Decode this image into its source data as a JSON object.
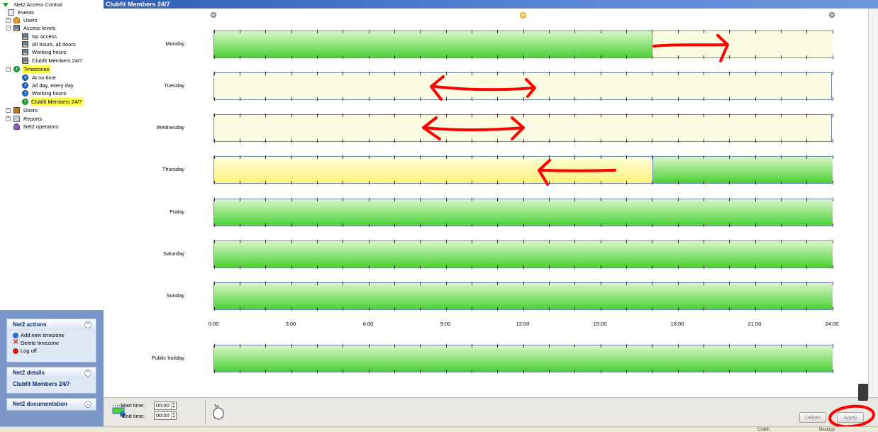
{
  "window": {
    "title": "Clubfit Members 24/7"
  },
  "tree": {
    "root": "Net2 Access Control",
    "events": "Events",
    "users": "Users",
    "access_levels": "Access levels",
    "access_level_items": [
      "No access",
      "All hours, all doors",
      "Working hours",
      "Clubfit Members 24/7"
    ],
    "timezones": "Timezones",
    "timezone_items": [
      "At no time",
      "All day, every day",
      "Working hours",
      "Clubfit Members 24/7"
    ],
    "doors": "Doors",
    "reports": "Reports",
    "operators": "Net2 operators"
  },
  "panels": {
    "actions": {
      "title": "Net2 actions",
      "items": [
        "Add new timezone",
        "Delete timezone",
        "Log off"
      ]
    },
    "details": {
      "title": "Net2 details",
      "value": "Clubfit Members 24/7"
    },
    "documentation": {
      "title": "Net2 documentation"
    }
  },
  "schedule": {
    "days": [
      {
        "label": "Monday",
        "on_from": 0,
        "on_to": 17
      },
      {
        "label": "Tuesday",
        "on_from": 0,
        "on_to": 0
      },
      {
        "label": "Wednesday",
        "on_from": 0,
        "on_to": 0
      },
      {
        "label": "Thursday",
        "on_from": 17,
        "on_to": 24
      },
      {
        "label": "Friday",
        "on_from": 0,
        "on_to": 24
      },
      {
        "label": "Saturday",
        "on_from": 0,
        "on_to": 24
      },
      {
        "label": "Sunday",
        "on_from": 0,
        "on_to": 24
      }
    ],
    "public_holiday": {
      "label": "Public holiday",
      "on_from": 0,
      "on_to": 24
    },
    "hour_labels": [
      "0:00",
      "3:00",
      "6:00",
      "9:00",
      "12:00",
      "15:00",
      "18:00",
      "21:00",
      "24:00"
    ]
  },
  "editor": {
    "start_label": "Start time:",
    "start_value": "00:00",
    "end_label": "End time:",
    "end_value": "00:00",
    "delete_label": "Delete",
    "apply_label": "Apply"
  },
  "status": {
    "cell1": "Clubfit",
    "cell2": "Desktop"
  },
  "colors": {
    "title_bar": "#2f5fb5",
    "on": "#4bd035",
    "off": "#fbfbe2",
    "highlight": "#ffff4a",
    "annotation": "#ff0000"
  }
}
